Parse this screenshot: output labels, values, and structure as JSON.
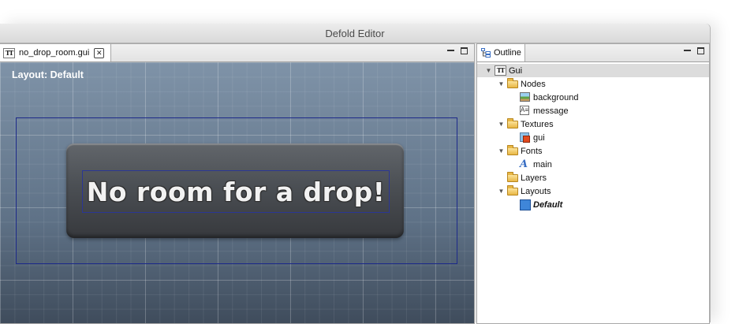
{
  "window": {
    "title": "Defold Editor"
  },
  "editor": {
    "tab_label": "no_drop_room.gui",
    "tab_icon": "gui-file-icon",
    "layout_label": "Layout: Default",
    "message_text": "No room for a drop!"
  },
  "outline": {
    "tab_label": "Outline",
    "tree": {
      "root": "Gui",
      "nodes": "Nodes",
      "background": "background",
      "message": "message",
      "textures": "Textures",
      "gui_texture": "gui",
      "fonts": "Fonts",
      "main_font": "main",
      "layers": "Layers",
      "layouts": "Layouts",
      "default_layout": "Default"
    }
  },
  "colors": {
    "canvas_top": "#7f93a8",
    "canvas_bottom": "#3f4c5c",
    "guide_border": "#1d2a8a",
    "selection": "#dcdcdc"
  }
}
